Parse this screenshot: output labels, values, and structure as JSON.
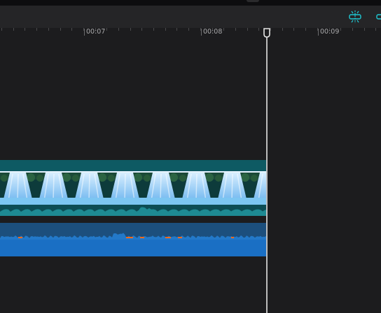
{
  "toolbar": {
    "buttons": [
      {
        "icon": "link-clips-icon",
        "color": "#1ec9d4"
      },
      {
        "icon": "split-icon",
        "color": "#1ec9d4"
      }
    ]
  },
  "ruler": {
    "labels": [
      "00:07",
      "00:08",
      "00:09"
    ]
  },
  "colors": {
    "background": "#1c1c1e",
    "toolbar": "#252527",
    "video_clip": "#0f5961",
    "audio_clip": "#1c4f7d",
    "audio_fill": "#1a6fc4",
    "audio_peaks": "#ff6a1a",
    "playhead": "#bdbdbd",
    "accent": "#1ec9d4"
  }
}
